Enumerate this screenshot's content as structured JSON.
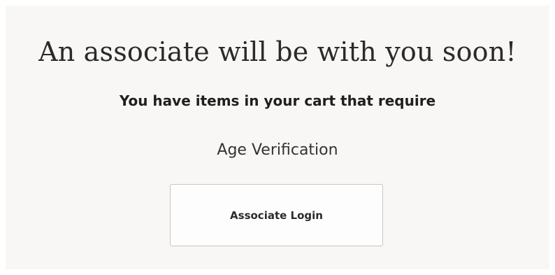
{
  "message": {
    "heading": "An associate will be with you soon!",
    "subheading": "You have items in your cart that require",
    "requirement": "Age Verification"
  },
  "actions": {
    "associate_login_label": "Associate Login"
  }
}
